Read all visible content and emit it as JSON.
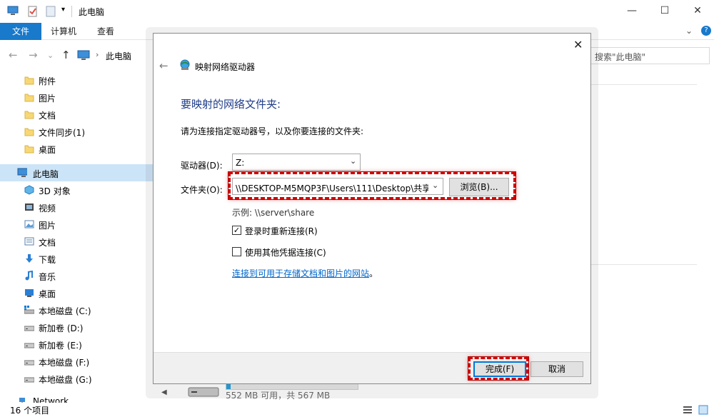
{
  "window": {
    "title": "此电脑",
    "minimize": "—",
    "maximize": "☐",
    "close": "✕"
  },
  "ribbon": {
    "file_tab": "文件",
    "tabs": [
      "计算机",
      "查看"
    ],
    "collapse": "⌄",
    "help": "?"
  },
  "address": {
    "path": "此电脑",
    "separator": "›",
    "search_placeholder": "搜索\"此电脑\"",
    "back": "←",
    "forward": "→",
    "up": "↑",
    "recent": "⌄"
  },
  "sidebar": {
    "quick_access": [
      {
        "label": "附件",
        "icon": "folder-icon"
      },
      {
        "label": "图片",
        "icon": "folder-icon"
      },
      {
        "label": "文档",
        "icon": "folder-icon"
      },
      {
        "label": "文件同步(1)",
        "icon": "folder-icon"
      },
      {
        "label": "桌面",
        "icon": "folder-icon"
      }
    ],
    "this_pc": {
      "label": "此电脑",
      "icon": "computer-icon"
    },
    "pc_items": [
      {
        "label": "3D 对象",
        "icon": "3d-objects-icon"
      },
      {
        "label": "视频",
        "icon": "video-icon"
      },
      {
        "label": "图片",
        "icon": "pictures-icon"
      },
      {
        "label": "文档",
        "icon": "documents-icon"
      },
      {
        "label": "下载",
        "icon": "download-icon"
      },
      {
        "label": "音乐",
        "icon": "music-icon"
      },
      {
        "label": "桌面",
        "icon": "desktop-icon"
      },
      {
        "label": "本地磁盘 (C:)",
        "icon": "drive-icon"
      },
      {
        "label": "新加卷 (D:)",
        "icon": "drive-icon"
      },
      {
        "label": "新加卷 (E:)",
        "icon": "drive-icon"
      },
      {
        "label": "本地磁盘 (F:)",
        "icon": "drive-icon"
      },
      {
        "label": "本地磁盘 (G:)",
        "icon": "drive-icon"
      }
    ],
    "network": {
      "label": "Network",
      "icon": "network-icon"
    }
  },
  "main": {
    "drive_free_text": "552 MB 可用，共 567 MB",
    "drive_used_fraction": 0.03
  },
  "status": {
    "item_count": "16 个项目"
  },
  "dialog": {
    "window_title": "映射网络驱动器",
    "close": "✕",
    "back": "←",
    "heading": "要映射的网络文件夹:",
    "description": "请为连接指定驱动器号，以及你要连接的文件夹:",
    "drive_label": "驱动器(D):",
    "drive_value": "Z:",
    "folder_label": "文件夹(O):",
    "folder_value": "\\\\DESKTOP-M5MQP3F\\Users\\111\\Desktop\\共享",
    "browse_button": "浏览(B)...",
    "example": "示例: \\\\server\\share",
    "reconnect_label": "登录时重新连接(R)",
    "reconnect_checked": "✓",
    "other_credentials_label": "使用其他凭据连接(C)",
    "link_text": "连接到可用于存储文档和图片的网站",
    "link_suffix": "。",
    "finish_button": "完成(F)",
    "cancel_button": "取消"
  },
  "colors": {
    "accent": "#1979ca",
    "selection": "#cce4f7",
    "highlight_box": "#d40000",
    "link": "#0066cc",
    "heading": "#1e3d8a"
  }
}
